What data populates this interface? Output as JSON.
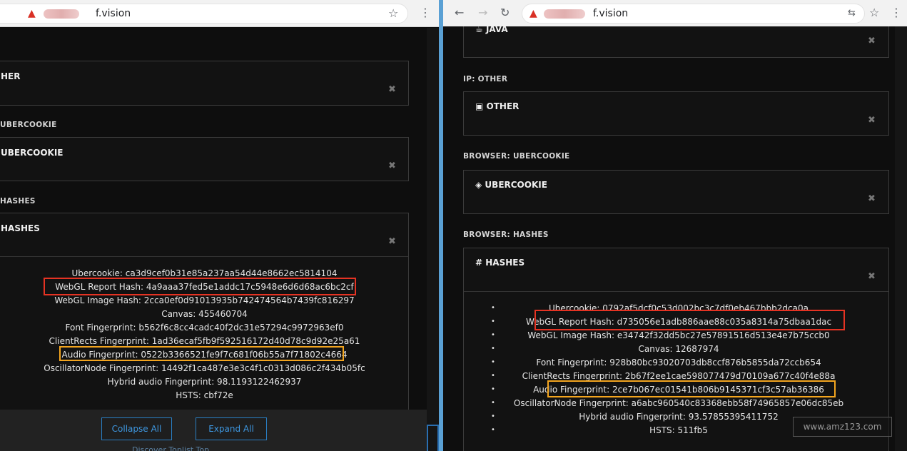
{
  "left_browser": {
    "url_host": "f.vision",
    "sections": [
      {
        "label": "",
        "title": "HER"
      },
      {
        "label": "UBERCOOKIE",
        "title": "UBERCOOKIE"
      },
      {
        "label": "HASHES",
        "title": "HASHES"
      }
    ],
    "fingerprints": [
      "Ubercookie: ca3d9cef0b31e85a237aa54d44e8662ec5814104",
      "WebGL Report Hash: 4a9aaa37fed5e1addc17c5948e6d6d68ac6bc2cf",
      "WebGL Image Hash: 2cca0ef0d91013935b742474564b7439fc816297",
      "Canvas: 455460704",
      "Font Fingerprint: b562f6c8cc4cadc40f2dc31e57294c9972963ef0",
      "ClientRects Fingerprint: 1ad36ecaf5fb9f592516172d40d78c9d92e25a61",
      "Audio Fingerprint: 0522b3366521fe9f7c681f06b55a7f71802c4664",
      "OscillatorNode Fingerprint: 14492f1ca487e3e3c4f1c0313d086c2f434b05fc",
      "Hybrid audio Fingerprint: 98.1193122462937",
      "HSTS: cbf72e"
    ],
    "buttons": {
      "collapse_all": "Collapse All",
      "expand_all": "Expand All"
    },
    "footer_text": "Discover Toplist Top"
  },
  "right_browser": {
    "url_host": "f.vision",
    "sections": [
      {
        "label": "",
        "title": "JAVA"
      },
      {
        "label": "IP: OTHER",
        "title": "OTHER"
      },
      {
        "label": "BROWSER: UBERCOOKIE",
        "title": "UBERCOOKIE"
      },
      {
        "label": "BROWSER: HASHES",
        "title": "HASHES"
      }
    ],
    "fingerprints": [
      "Ubercookie: 0792af5dcf0c53d002bc3c7df0eb467bbb2dca0a",
      "WebGL Report Hash: d735056e1adb886aae88c035a8314a75dbaa1dac",
      "WebGL Image Hash: e34742f32dd5bc27e57891516d513e4e7b75ccb0",
      "Canvas: 12687974",
      "Font Fingerprint: 928b80bc93020703db8ccf876b5855da72ccb654",
      "ClientRects Fingerprint: 2b67f2ee1cae598077479d70109a677c40f4e88a",
      "Audio Fingerprint: 2ce7b067ec01541b806b9145371cf3c57ab36386",
      "OscillatorNode Fingerprint: a6abc960540c83368ebb58f74965857e06dc85eb",
      "Hybrid audio Fingerprint: 93.57855395411752",
      "HSTS: 511fb5"
    ]
  },
  "watermark": "www.amz123.com",
  "colors": {
    "highlight_red": "#e53323",
    "highlight_orange": "#f3a51f",
    "button_blue": "#3e97e0"
  }
}
